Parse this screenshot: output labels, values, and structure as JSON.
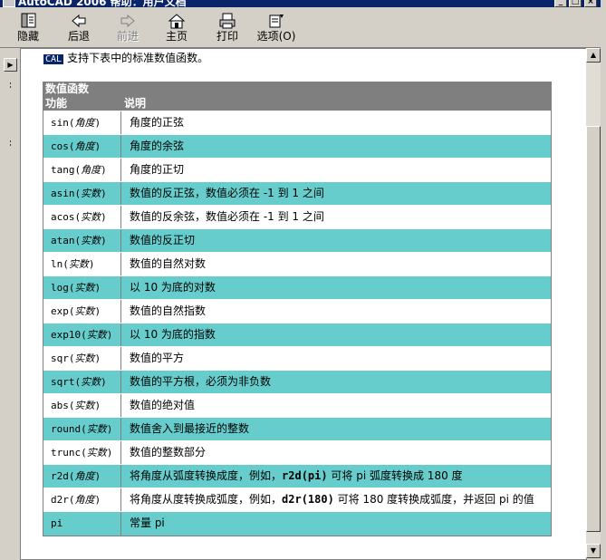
{
  "window": {
    "title": "AutoCAD 2006 帮助：用户文档"
  },
  "toolbar": {
    "buttons": [
      {
        "label": "隐藏",
        "icon": "hide-icon"
      },
      {
        "label": "后退",
        "icon": "back-arrow-icon"
      },
      {
        "label": "前进",
        "icon": "forward-arrow-icon",
        "disabled": true
      },
      {
        "label": "主页",
        "icon": "home-icon"
      },
      {
        "label": "打印",
        "icon": "printer-icon"
      },
      {
        "label": "选项(O)",
        "icon": "options-icon"
      }
    ]
  },
  "content": {
    "badge": "CAL",
    "intro": "支持下表中的标准数值函数。",
    "table": {
      "caption": "数值函数",
      "col1": "功能",
      "col2": "说明",
      "rows": [
        {
          "fn": "sin(",
          "arg": "角度",
          "close": ")",
          "desc_pre": "角度的正弦"
        },
        {
          "fn": "cos(",
          "arg": "角度",
          "close": ")",
          "desc_pre": "角度的余弦"
        },
        {
          "fn": "tang(",
          "arg": "角度",
          "close": ")",
          "desc_pre": "角度的正切"
        },
        {
          "fn": "asin(",
          "arg": "实数",
          "close": ")",
          "desc_pre": "数值的反正弦，数值必须在 -1 到 1 之间"
        },
        {
          "fn": "acos(",
          "arg": "实数",
          "close": ")",
          "desc_pre": "数值的反余弦，数值必须在 -1 到 1 之间"
        },
        {
          "fn": "atan(",
          "arg": "实数",
          "close": ")",
          "desc_pre": "数值的反正切"
        },
        {
          "fn": "ln(",
          "arg": "实数",
          "close": ")",
          "desc_pre": "数值的自然对数"
        },
        {
          "fn": "log(",
          "arg": "实数",
          "close": ")",
          "desc_pre": "以 10 为底的对数"
        },
        {
          "fn": "exp(",
          "arg": "实数",
          "close": ")",
          "desc_pre": "数值的自然指数"
        },
        {
          "fn": "exp10(",
          "arg": "实数",
          "close": ")",
          "desc_pre": "以 10 为底的指数"
        },
        {
          "fn": "sqr(",
          "arg": "实数",
          "close": ")",
          "desc_pre": "数值的平方"
        },
        {
          "fn": "sqrt(",
          "arg": "实数",
          "close": ")",
          "desc_pre": "数值的平方根，必须为非负数"
        },
        {
          "fn": "abs(",
          "arg": "实数",
          "close": ")",
          "desc_pre": "数值的绝对值"
        },
        {
          "fn": "round(",
          "arg": "实数",
          "close": ")",
          "desc_pre": "数值舍入到最接近的整数"
        },
        {
          "fn": "trunc(",
          "arg": "实数",
          "close": ")",
          "desc_pre": "数值的整数部分"
        },
        {
          "fn": "r2d(",
          "arg": "角度",
          "close": ")",
          "desc_pre": "将角度从弧度转换成度，例如，",
          "desc_bold": "r2d(pi)",
          "desc_post": " 可将 pi 弧度转换成 180 度"
        },
        {
          "fn": "d2r(",
          "arg": "角度",
          "close": ")",
          "desc_pre": "将角度从度转换成弧度，例如，",
          "desc_bold": "d2r(180)",
          "desc_post": " 可将 180 度转换成弧度，并返回 pi 的值"
        },
        {
          "fn": "pi",
          "arg": "",
          "close": "",
          "desc_pre": "常量 pi"
        }
      ]
    }
  }
}
